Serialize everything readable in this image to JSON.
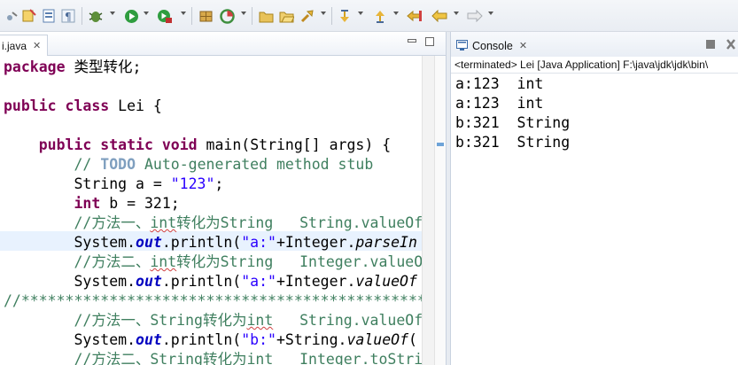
{
  "toolbar": {
    "icons": [
      "skip-all-breakpoints-icon",
      "new-class-icon",
      "open-type-icon",
      "show-whitespace-icon",
      "debug-icon",
      "run-icon",
      "external-tools-icon",
      "new-package-icon",
      "coverage-icon",
      "open-folder-icon",
      "open-project-icon",
      "search-icon",
      "next-annotation-icon",
      "prev-annotation-icon",
      "last-edit-icon",
      "back-icon",
      "forward-icon"
    ]
  },
  "editor": {
    "tab_label": "i.java",
    "close_glyph": "✕",
    "lines": [
      [
        {
          "t": "package",
          "c": "kw"
        },
        {
          "t": " 类型转化;"
        }
      ],
      [],
      [
        {
          "t": "public",
          "c": "kw"
        },
        {
          "t": " "
        },
        {
          "t": "class",
          "c": "kw"
        },
        {
          "t": " Lei {"
        }
      ],
      [],
      [
        {
          "t": "    "
        },
        {
          "t": "public",
          "c": "kw"
        },
        {
          "t": " "
        },
        {
          "t": "static",
          "c": "kw"
        },
        {
          "t": " "
        },
        {
          "t": "void",
          "c": "kw"
        },
        {
          "t": " main(String[] args) {"
        }
      ],
      [
        {
          "t": "        "
        },
        {
          "t": "// ",
          "c": "cm"
        },
        {
          "t": "TODO",
          "c": "todo"
        },
        {
          "t": " Auto-generated method stub",
          "c": "cm"
        }
      ],
      [
        {
          "t": "        String a = "
        },
        {
          "t": "\"123\"",
          "c": "str"
        },
        {
          "t": ";"
        }
      ],
      [
        {
          "t": "        "
        },
        {
          "t": "int",
          "c": "kw"
        },
        {
          "t": " b = 321;"
        }
      ],
      [
        {
          "t": "        "
        },
        {
          "t": "//方法一、",
          "c": "cm"
        },
        {
          "t": "int",
          "c": "cm squig"
        },
        {
          "t": "转化为String   String.valueOf",
          "c": "cm"
        }
      ],
      [
        {
          "t": "        System."
        },
        {
          "t": "out",
          "c": "fld"
        },
        {
          "t": ".println("
        },
        {
          "t": "\"a:\"",
          "c": "str"
        },
        {
          "t": "+Integer."
        },
        {
          "t": "parseIn",
          "c": "it"
        }
      ],
      [
        {
          "t": "        "
        },
        {
          "t": "//方法二、",
          "c": "cm"
        },
        {
          "t": "int",
          "c": "cm squig"
        },
        {
          "t": "转化为String   Integer.valueO",
          "c": "cm"
        }
      ],
      [
        {
          "t": "        System."
        },
        {
          "t": "out",
          "c": "fld"
        },
        {
          "t": ".println("
        },
        {
          "t": "\"a:\"",
          "c": "str"
        },
        {
          "t": "+Integer."
        },
        {
          "t": "valueOf",
          "c": "it"
        }
      ],
      [
        {
          "t": "//*******************************************************",
          "c": "cm"
        }
      ],
      [
        {
          "t": "        "
        },
        {
          "t": "//方法一、String转化为",
          "c": "cm"
        },
        {
          "t": "int",
          "c": "cm squig"
        },
        {
          "t": "   String.valueOf",
          "c": "cm"
        }
      ],
      [
        {
          "t": "        System."
        },
        {
          "t": "out",
          "c": "fld"
        },
        {
          "t": ".println("
        },
        {
          "t": "\"b:\"",
          "c": "str"
        },
        {
          "t": "+String."
        },
        {
          "t": "valueOf",
          "c": "it"
        },
        {
          "t": "("
        }
      ],
      [
        {
          "t": "        "
        },
        {
          "t": "//方法二、String转化为",
          "c": "cm"
        },
        {
          "t": "int",
          "c": "cm squig"
        },
        {
          "t": "   Integer.toStri",
          "c": "cm"
        }
      ]
    ]
  },
  "console": {
    "tab_label": "Console",
    "close_glyph": "✕",
    "header": "<terminated> Lei [Java Application] F:\\java\\jdk\\jdk\\bin\\",
    "lines": [
      "a:123  int",
      "a:123  int",
      "b:321  String",
      "b:321  String"
    ]
  },
  "colors": {
    "keyword": "#7f0055",
    "string": "#2a00ff",
    "comment": "#3f7f5f",
    "field": "#0000c0",
    "current_line": "#e8f2fe"
  }
}
